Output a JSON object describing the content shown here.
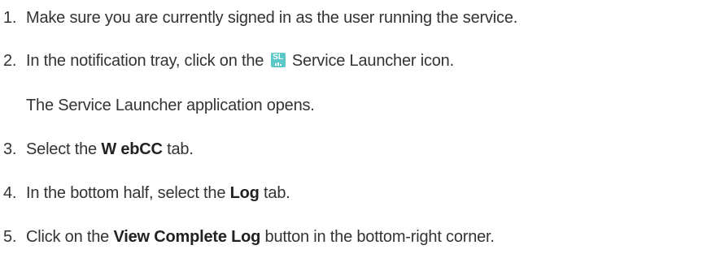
{
  "steps": [
    {
      "number": "1.",
      "text": "Make sure you are currently signed in as the user running the service."
    },
    {
      "number": "2.",
      "text_before": "In the notification tray, click on the",
      "icon_text": "SL",
      "text_after": "Service Launcher icon."
    },
    {
      "continuation": "The Service Launcher application opens."
    },
    {
      "number": "3.",
      "text_before": "Select the",
      "bold": "W ebCC",
      "text_after": "tab."
    },
    {
      "number": "4.",
      "text_before": "In the bottom half, select the",
      "bold": "Log",
      "text_after": "tab."
    },
    {
      "number": "5.",
      "text_before": "Click on the",
      "bold": "View Complete Log",
      "text_after": "button in the bottom-right corner."
    }
  ],
  "icons": {
    "service_launcher": "service-launcher-icon",
    "service_launcher_color": "#5cc8c8"
  }
}
